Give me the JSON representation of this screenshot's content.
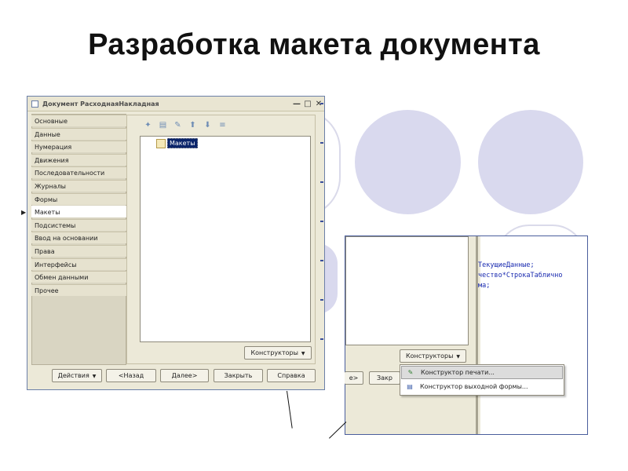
{
  "slide": {
    "title": "Разработка макета документа"
  },
  "window": {
    "title": "Документ РасходнаяНакладная",
    "minimize_icon": "minimize-icon",
    "maximize_icon": "maximize-icon",
    "close_icon": "close-icon"
  },
  "nav": {
    "items": [
      {
        "label": "Основные"
      },
      {
        "label": "Данные"
      },
      {
        "label": "Нумерация"
      },
      {
        "label": "Движения"
      },
      {
        "label": "Последовательности"
      },
      {
        "label": "Журналы"
      },
      {
        "label": "Формы"
      },
      {
        "label": "Макеты"
      },
      {
        "label": "Подсистемы"
      },
      {
        "label": "Ввод на основании"
      },
      {
        "label": "Права"
      },
      {
        "label": "Интерфейсы"
      },
      {
        "label": "Обмен данными"
      },
      {
        "label": "Прочее"
      }
    ],
    "active": "Макеты"
  },
  "tree": {
    "root_label": "Макеты"
  },
  "buttons": {
    "constructors": "Конструкторы",
    "actions": "Действия",
    "back": "<Назад",
    "next": "Далее>",
    "close": "Закрыть",
    "help": "Справка"
  },
  "panel2": {
    "code_lines": [
      "ТекущиеДанные;",
      "чество*СтрокаТаблично",
      "ма;"
    ],
    "constructors": "Конструкторы",
    "partial_left": "е>",
    "partial_close": "Закр"
  },
  "dropdown": {
    "items": [
      {
        "label": "Конструктор печати...",
        "icon": "print-constructor-icon"
      },
      {
        "label": "Конструктор выходной формы...",
        "icon": "output-form-constructor-icon"
      }
    ]
  },
  "colors": {
    "circle_fill": "#d9d9ee",
    "window_bg": "#ece9d8",
    "selection": "#0a246a",
    "code_text": "#1a2bb0"
  }
}
